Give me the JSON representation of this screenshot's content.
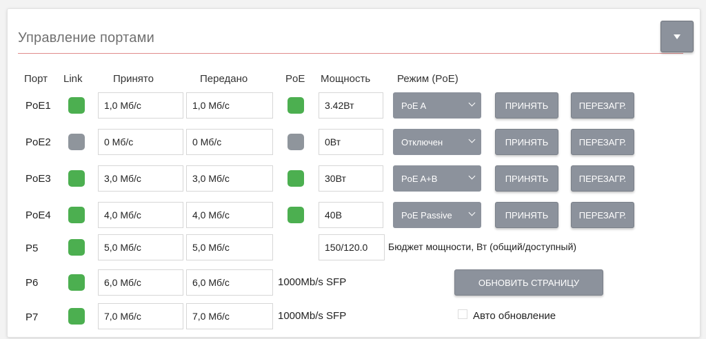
{
  "panel": {
    "title": "Управление портами"
  },
  "headers": {
    "port": "Порт",
    "link": "Link",
    "rx": "Принято",
    "tx": "Передано",
    "poe": "PoE",
    "power": "Мощность",
    "mode": "Режим (PoE)"
  },
  "rows": [
    {
      "port": "PoE1",
      "link": "on",
      "rx": "1,0 Мб/с",
      "tx": "1,0 Мб/с",
      "poe": "on",
      "power": "3.42Вт",
      "mode": "PoE A",
      "apply": "ПРИНЯТЬ",
      "reboot": "ПЕРЕЗАГР."
    },
    {
      "port": "PoE2",
      "link": "off",
      "rx": "0 Мб/с",
      "tx": "0 Мб/с",
      "poe": "off",
      "power": "0Вт",
      "mode": "Отключен",
      "apply": "ПРИНЯТЬ",
      "reboot": "ПЕРЕЗАГР."
    },
    {
      "port": "PoE3",
      "link": "on",
      "rx": "3,0 Мб/с",
      "tx": "3,0 Мб/с",
      "poe": "on",
      "power": "30Вт",
      "mode": "PoE A+B",
      "apply": "ПРИНЯТЬ",
      "reboot": "ПЕРЕЗАГР."
    },
    {
      "port": "PoE4",
      "link": "on",
      "rx": "4,0 Мб/с",
      "tx": "4,0 Мб/с",
      "poe": "on",
      "power": "40В",
      "mode": "PoE Passive",
      "apply": "ПРИНЯТЬ",
      "reboot": "ПЕРЕЗАГР."
    },
    {
      "port": "P5",
      "link": "on",
      "rx": "5,0 Мб/с",
      "tx": "5,0 Мб/с"
    },
    {
      "port": "P6",
      "link": "on",
      "rx": "6,0 Мб/с",
      "tx": "6,0 Мб/с",
      "sfp": "1000Mb/s SFP"
    },
    {
      "port": "P7",
      "link": "on",
      "rx": "7,0 Мб/с",
      "tx": "7,0 Мб/с",
      "sfp": "1000Mb/s SFP"
    }
  ],
  "budget": {
    "value": "150/120.0",
    "label": "Бюджет мощности, Вт (общий/доступный)"
  },
  "refresh_button": "ОБНОВИТЬ СТРАНИЦУ",
  "auto_refresh": {
    "label": "Авто обновление",
    "checked": false
  },
  "colors": {
    "led_on": "#4caf50",
    "led_off": "#8f959c",
    "button": "#8c929c",
    "title_line": "#e08b8b"
  }
}
